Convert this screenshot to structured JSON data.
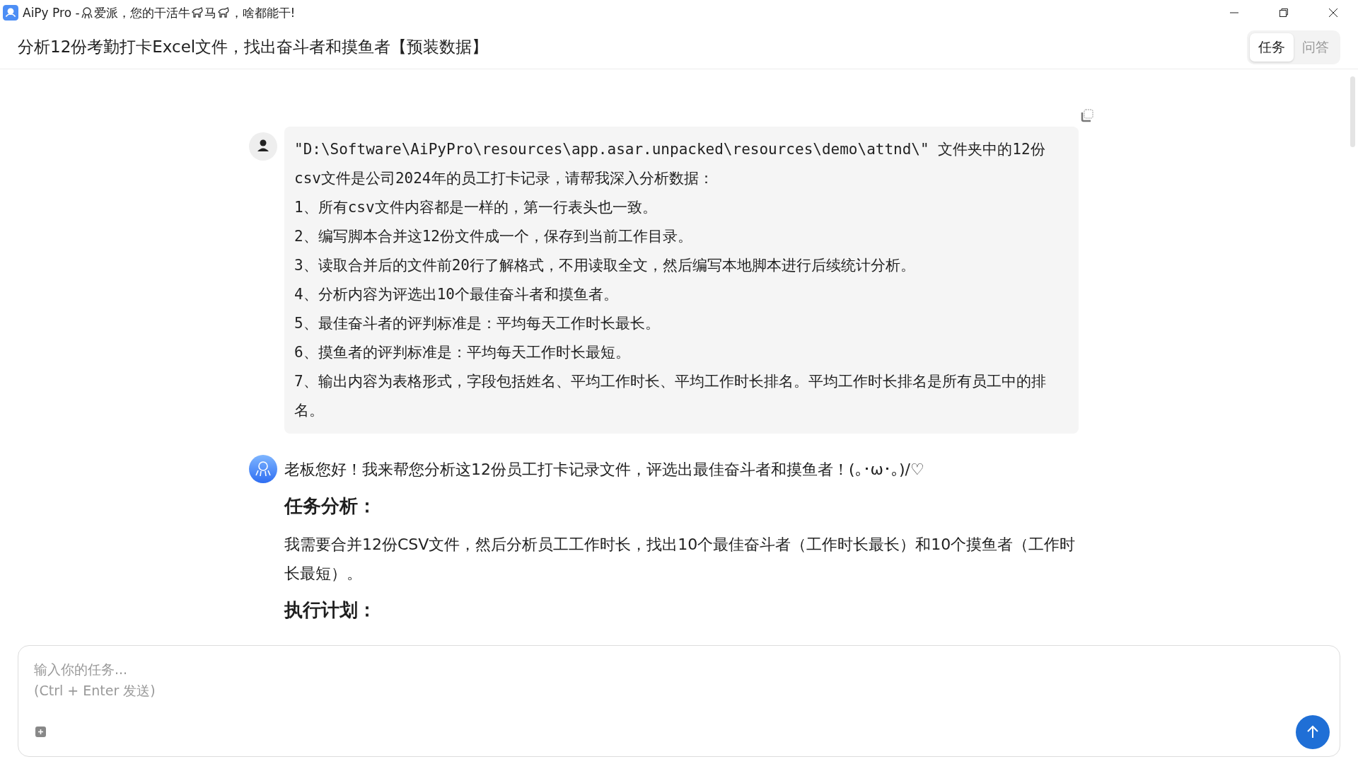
{
  "window": {
    "title_parts": [
      "AiPy Pro - ",
      "爱派，您的干活牛",
      "马",
      "，啥都能干!"
    ]
  },
  "header": {
    "title": "分析12份考勤打卡Excel文件，找出奋斗者和摸鱼者【预装数据】",
    "tabs": [
      {
        "label": "任务",
        "selected": true
      },
      {
        "label": "问答",
        "selected": false
      }
    ]
  },
  "messages": [
    {
      "kind": "user",
      "paragraphs": [
        "\"D:\\Software\\AiPyPro\\resources\\app.asar.unpacked\\resources\\demo\\attnd\\\" 文件夹中的12份csv文件是公司2024年的员工打卡记录，请帮我深入分析数据：",
        "1、所有csv文件内容都是一样的，第一行表头也一致。",
        "2、编写脚本合并这12份文件成一个，保存到当前工作目录。",
        "3、读取合并后的文件前20行了解格式，不用读取全文，然后编写本地脚本进行后续统计分析。",
        "4、分析内容为评选出10个最佳奋斗者和摸鱼者。",
        "5、最佳奋斗者的评判标准是：平均每天工作时长最长。",
        "6、摸鱼者的评判标准是：平均每天工作时长最短。",
        "7、输出内容为表格形式，字段包括姓名、平均工作时长、平均工作时长排名。平均工作时长排名是所有员工中的排名。"
      ]
    },
    {
      "kind": "assistant",
      "blocks": [
        {
          "kind": "text",
          "text": "老板您好！我来帮您分析这12份员工打卡记录文件，评选出最佳奋斗者和摸鱼者！(｡･ω･｡)/♡"
        },
        {
          "kind": "heading",
          "text": "任务分析："
        },
        {
          "kind": "text",
          "text": "我需要合并12份CSV文件，然后分析员工工作时长，找出10个最佳奋斗者（工作时长最长）和10个摸鱼者（工作时长最短）。"
        },
        {
          "kind": "heading",
          "text": "执行计划："
        }
      ]
    }
  ],
  "composer": {
    "placeholder": "输入你的任务...\n(Ctrl + Enter 发送)"
  }
}
